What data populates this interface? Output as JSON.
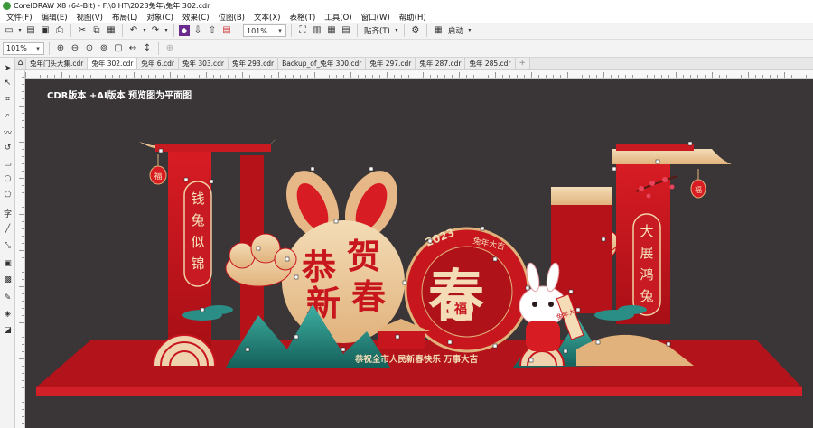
{
  "window": {
    "title": "CorelDRAW X8 (64-Bit) - F:\\0 HT\\2023兔年\\兔年 302.cdr"
  },
  "menu": [
    "文件(F)",
    "编辑(E)",
    "视图(V)",
    "布局(L)",
    "对象(C)",
    "效果(C)",
    "位图(B)",
    "文本(X)",
    "表格(T)",
    "工具(O)",
    "窗口(W)",
    "帮助(H)"
  ],
  "toolbar": {
    "zoom_value": "101%",
    "snap_label": "贴齐(T)",
    "launch_label": "启动"
  },
  "propertybar": {
    "zoom_value": "101%"
  },
  "tabs": [
    "兔年门头大集.cdr",
    "兔年 302.cdr",
    "兔年 6.cdr",
    "兔年 303.cdr",
    "兔年 293.cdr",
    "Backup_of_兔年 300.cdr",
    "兔年 297.cdr",
    "兔年 287.cdr",
    "兔年 285.cdr"
  ],
  "active_tab": "兔年 302.cdr",
  "canvas": {
    "note": "CDR版本 +AI版本  预览图为平面图",
    "artwork": {
      "left_banner": [
        "钱",
        "兔",
        "似",
        "锦"
      ],
      "right_banner": [
        "大",
        "展",
        "鸿",
        "兔"
      ],
      "lantern": "福",
      "main_title": [
        "恭",
        "贺",
        "新",
        "春"
      ],
      "circle_char": "春",
      "circle_fu": "福",
      "arc_text": "2023",
      "arc_text_right": "兔年大吉",
      "scroll_text": "兔年大吉",
      "bottom_slogan": "恭祝全市人民新春快乐  万事大吉"
    },
    "colors": {
      "background": "#3a3536",
      "red": "#c8161e",
      "dark_red": "#9a1016",
      "gold": "#e9c89a",
      "teal": "#2a8e86"
    }
  }
}
